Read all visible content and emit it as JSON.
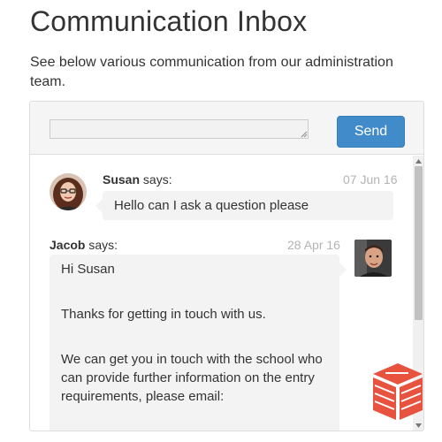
{
  "page": {
    "title": "Communication Inbox",
    "intro": "See below various communication from our administration team."
  },
  "composer": {
    "value": "",
    "placeholder": "",
    "send_label": "Send"
  },
  "messages": [
    {
      "sender": "Susan",
      "says": "says:",
      "date": "07 Jun 16",
      "body": [
        "Hello can I ask a question please"
      ],
      "side": "left"
    },
    {
      "sender": "Jacob",
      "says": "says:",
      "date": "28 Apr 16",
      "body": [
        "Hi Susan",
        "Thanks for getting in touch with us.",
        "We can get you in touch with the school who can provide further information on the entry requirements, please email:"
      ],
      "side": "right"
    }
  ],
  "icons": {
    "resize": "resize-grip-icon",
    "scroll_up": "arrow-up-icon",
    "scroll_down": "arrow-down-icon",
    "logo": "brand-logo"
  },
  "colors": {
    "accent": "#428bca",
    "bubble": "#f3f3f3",
    "date": "#b3b3b3",
    "logo": "#e8533f"
  }
}
